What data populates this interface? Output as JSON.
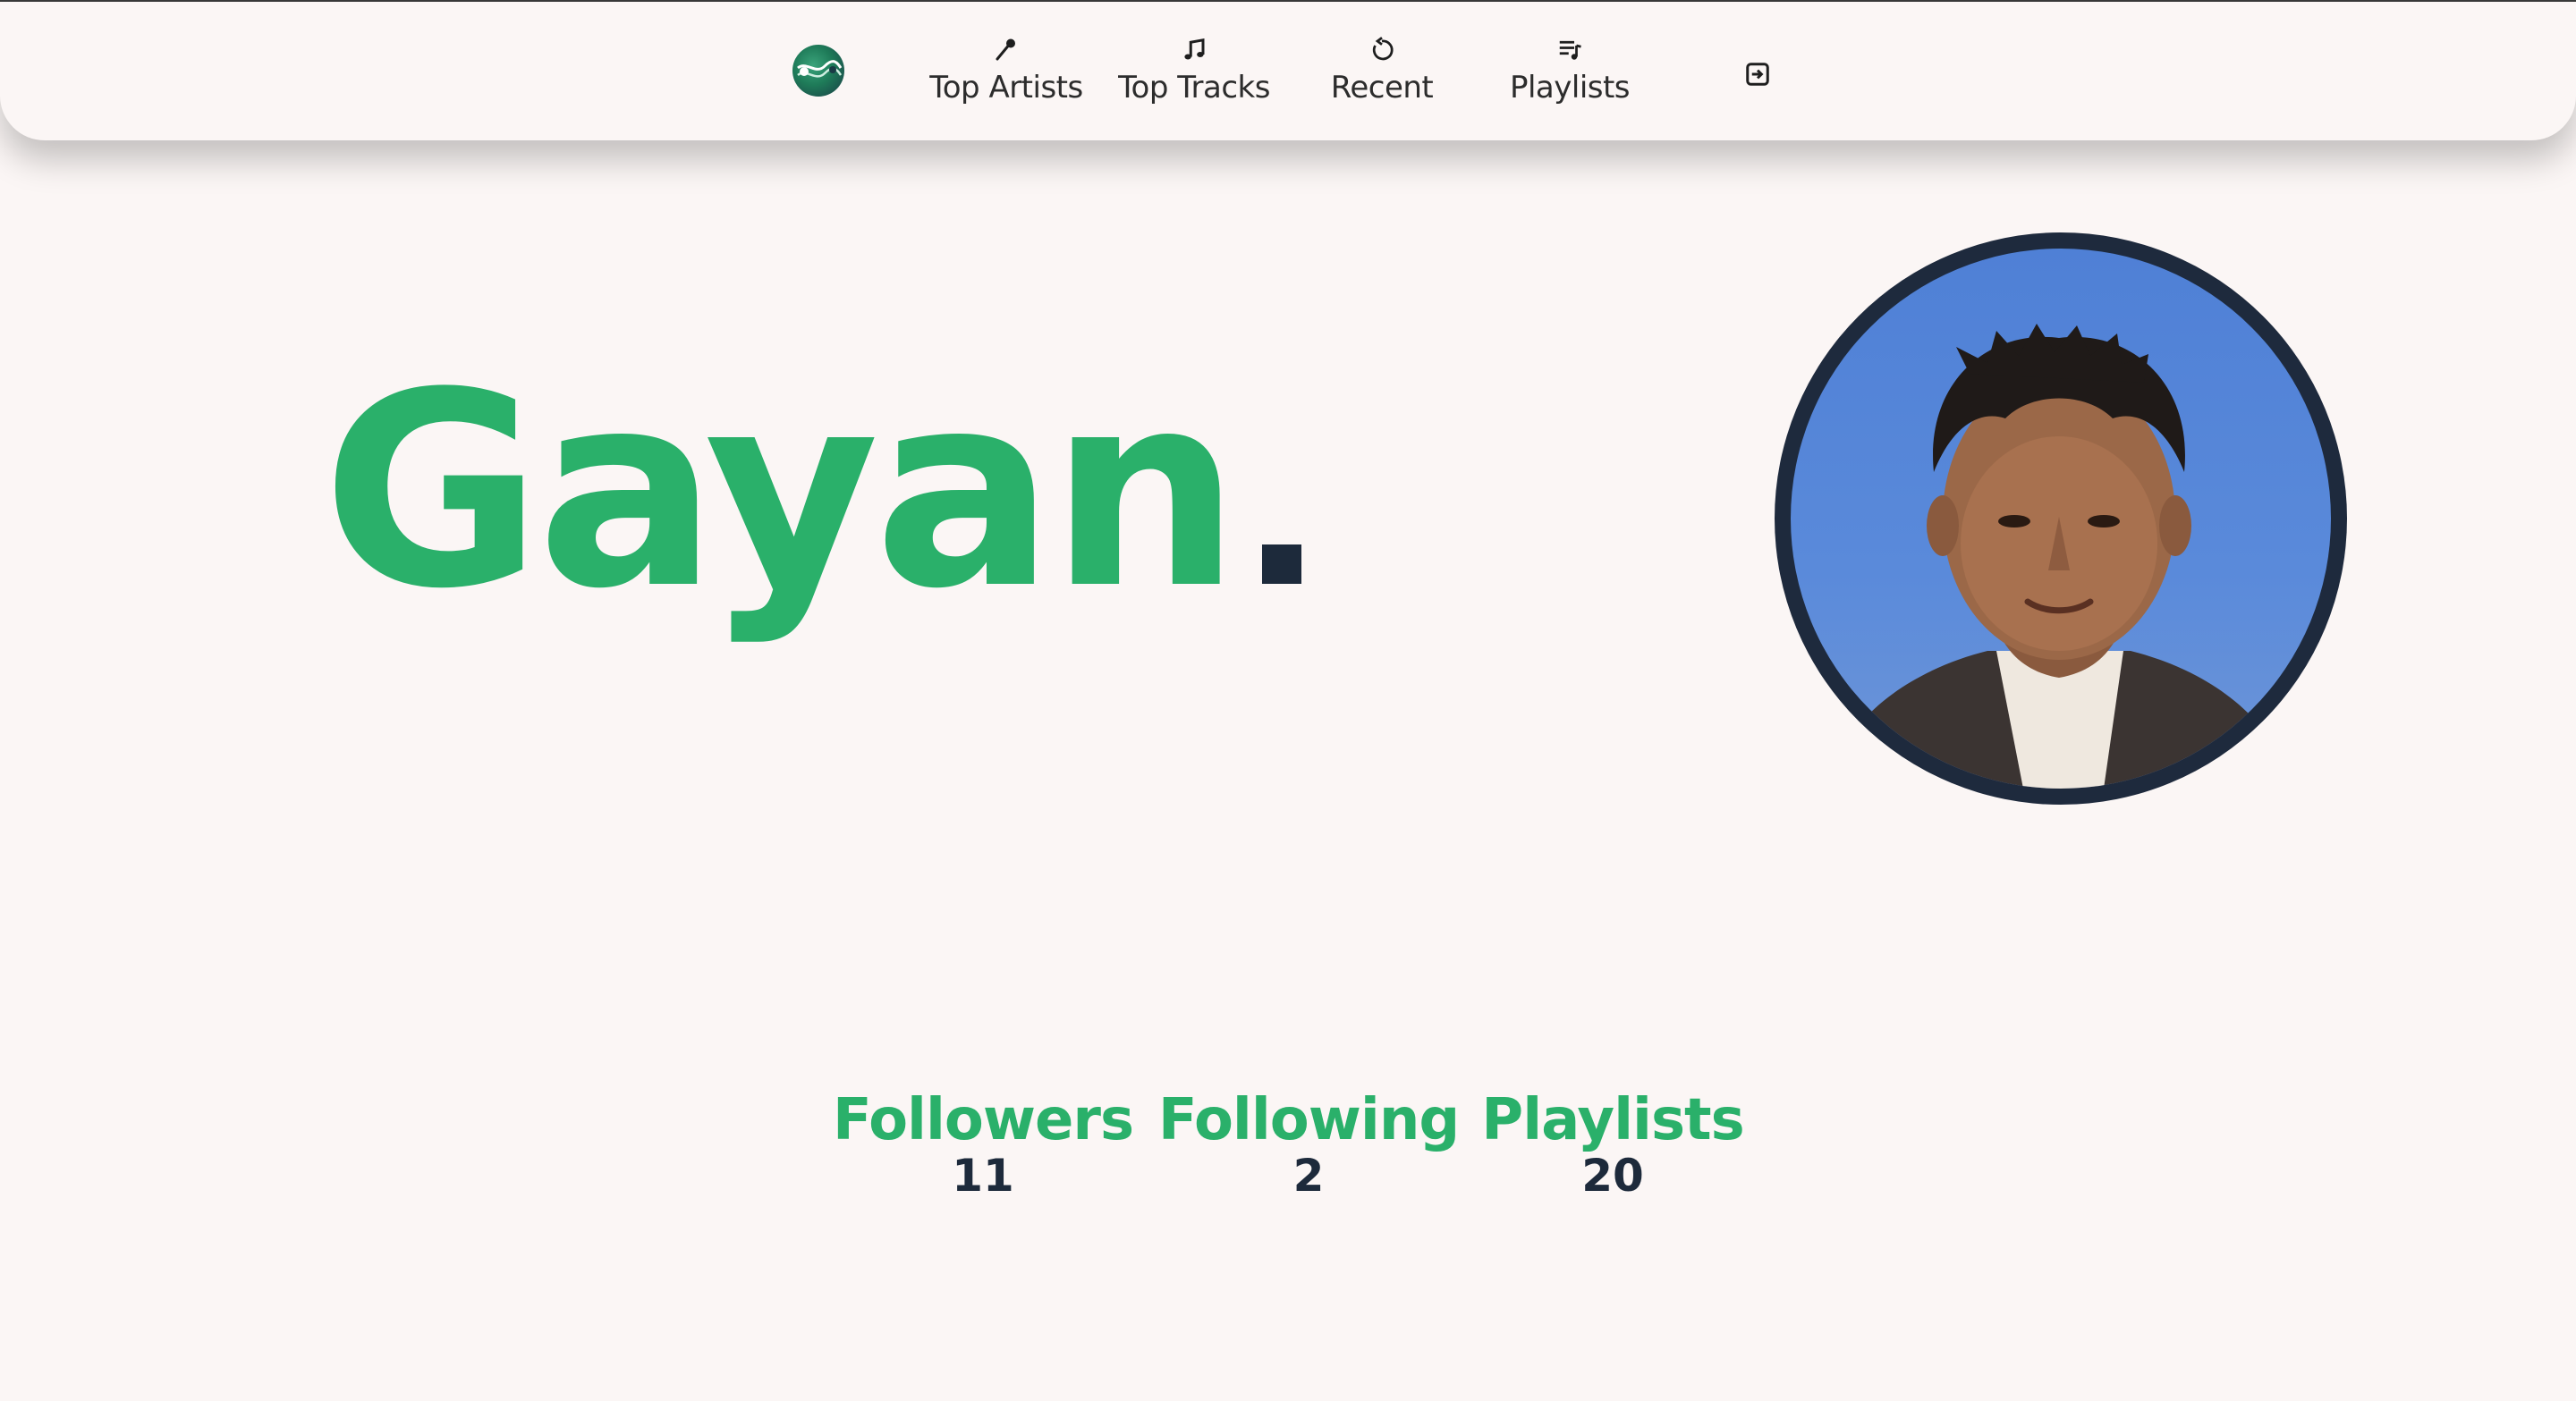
{
  "nav": {
    "logo_icon": "app-logo-icon",
    "items": [
      {
        "label": "Top Artists",
        "icon": "microphone-icon"
      },
      {
        "label": "Top Tracks",
        "icon": "music-note-icon"
      },
      {
        "label": "Recent",
        "icon": "refresh-icon"
      },
      {
        "label": "Playlists",
        "icon": "playlist-icon"
      }
    ],
    "logout_icon": "logout-icon"
  },
  "profile": {
    "name": "Gayan",
    "avatar": "profile-photo"
  },
  "stats": [
    {
      "label": "Followers",
      "value": "11"
    },
    {
      "label": "Following",
      "value": "2"
    },
    {
      "label": "Playlists",
      "value": "20"
    }
  ],
  "colors": {
    "accent": "#2ab06a",
    "dark": "#1d2a3b",
    "background": "#fbf6f5"
  }
}
